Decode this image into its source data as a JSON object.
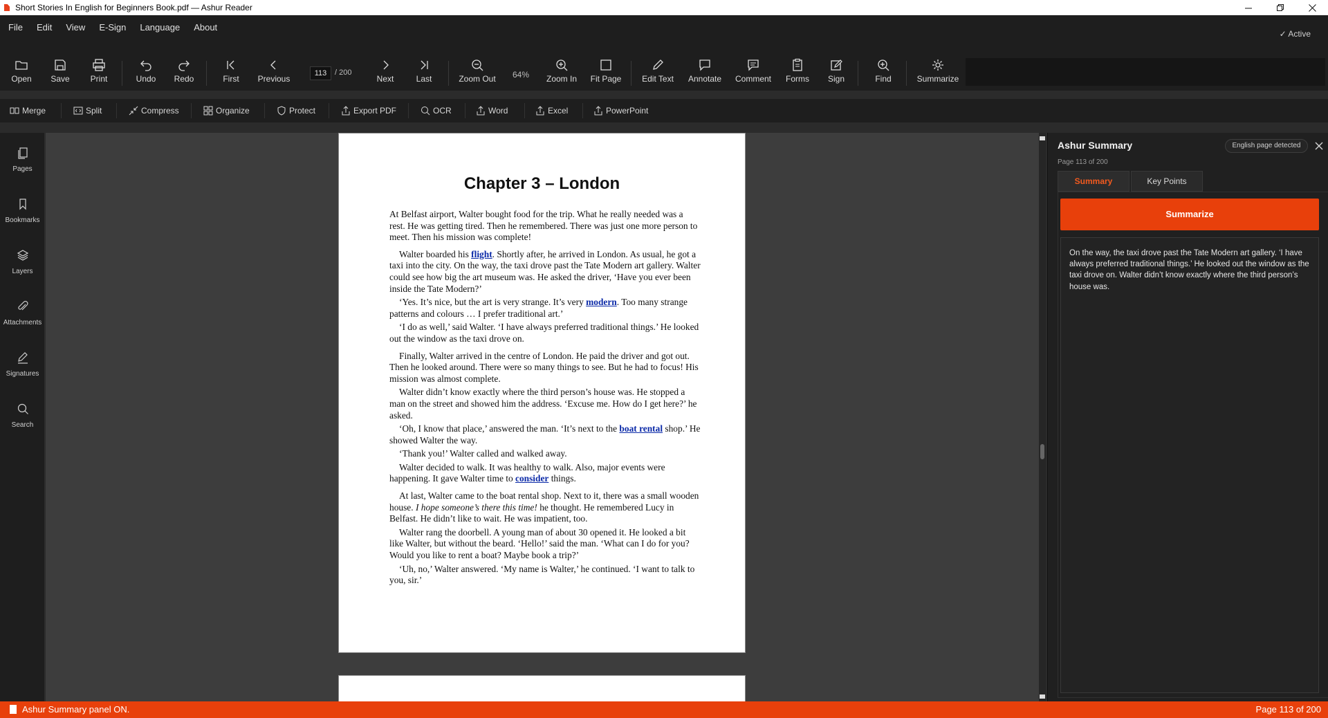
{
  "window": {
    "title": "Short Stories In English for Beginners Book.pdf — Ashur Reader",
    "minimize_glyph": "—",
    "restore_glyph": "❐",
    "close_glyph": "✕"
  },
  "menu": {
    "items": [
      "File",
      "Edit",
      "View",
      "E-Sign",
      "Language",
      "About"
    ],
    "status": "✓  Active"
  },
  "toolbar": {
    "open": "Open",
    "save": "Save",
    "print": "Print",
    "undo": "Undo",
    "redo": "Redo",
    "first": "First",
    "previous": "Previous",
    "page_current": "113",
    "page_total": "/ 200",
    "next": "Next",
    "last": "Last",
    "zoom_out": "Zoom Out",
    "zoom_level": "64%",
    "zoom_in": "Zoom In",
    "fit_page": "Fit Page",
    "edit_text": "Edit Text",
    "annotate": "Annotate",
    "comment": "Comment",
    "forms": "Forms",
    "sign": "Sign",
    "find": "Find",
    "summarize": "Summarize"
  },
  "toolbar2": {
    "merge": "Merge",
    "split": "Split",
    "compress": "Compress",
    "organize": "Organize",
    "protect": "Protect",
    "export_pdf": "Export PDF",
    "ocr": "OCR",
    "word": "Word",
    "excel": "Excel",
    "powerpoint": "PowerPoint"
  },
  "sidebar": {
    "pages": "Pages",
    "bookmarks": "Bookmarks",
    "layers": "Layers",
    "attachments": "Attachments",
    "signatures": "Signatures",
    "search": "Search"
  },
  "document": {
    "chapter_title": "Chapter 3 – London",
    "p1": "At Belfast airport, Walter bought food for the trip. What he really needed was a rest. He was getting tired. Then he remembered. There was just one more person to meet. Then his mission was complete!",
    "p2a": "Walter boarded his ",
    "p2_link": "flight",
    "p2b": ". Shortly after, he arrived in London. As usual, he got a taxi into the city. On the way, the taxi drove past the Tate Modern art gallery. Walter could see how big the art museum was. He asked the driver, ‘Have you ever been inside the Tate Modern?’",
    "p3a": "‘Yes. It’s nice, but the art is very strange. It’s very ",
    "p3_link": "modern",
    "p3b": ". Too many strange patterns and colours … I prefer traditional art.’",
    "p4": "‘I do as well,’ said Walter. ‘I have always preferred traditional things.’ He looked out the window as the taxi drove on.",
    "p5": "Finally, Walter arrived in the centre of London. He paid the driver and got out. Then he looked around. There were so many things to see. But he had to focus! His mission was almost complete.",
    "p6": "Walter didn’t know exactly where the third person’s house was. He stopped a man on the street and showed him the address. ‘Excuse me. How do I get here?’ he asked.",
    "p7a": "‘Oh, I know that place,’ answered the man. ‘It’s next to the ",
    "p7_link": "boat rental",
    "p7b": " shop.’ He showed Walter the way.",
    "p8": "‘Thank you!’ Walter called and walked away.",
    "p9a": "Walter decided to walk. It was healthy to walk. Also, major events were happening. It gave Walter time to ",
    "p9_link": "consider",
    "p9b": " things.",
    "p10a": "At last, Walter came to the boat rental shop. Next to it, there was a small wooden house. ",
    "p10_italic": "I hope someone’s there this time!",
    "p10b": " he thought. He remembered Lucy in Belfast. He didn’t like to wait. He was impatient, too.",
    "p11": "Walter rang the doorbell. A young man of about 30 opened it. He looked a bit like Walter, but without the beard. ‘Hello!’ said the man. ‘What can I do for you? Would you like to rent a boat? Maybe book a trip?’",
    "p12": "‘Uh, no,’ Walter answered. ‘My name is Walter,’ he continued. ‘I want to talk to you, sir.’"
  },
  "panel": {
    "title": "Ashur Summary",
    "subtitle": "Page 113 of 200",
    "badge": "English page detected",
    "tab_summary": "Summary",
    "tab_keypoints": "Key Points",
    "summarize_button": "Summarize",
    "summary_text": "On the way, the taxi drove past the Tate Modern art gallery. ‘I have always preferred traditional things.’ He looked out the window as the taxi drove on. Walter didn’t know exactly where the third person’s house was."
  },
  "status": {
    "left": "Ashur Summary panel ON.",
    "right": "Page 113 of 200"
  },
  "colors": {
    "accent": "#e8400b",
    "link": "#0b2aa8",
    "background": "#1e1e1e"
  }
}
